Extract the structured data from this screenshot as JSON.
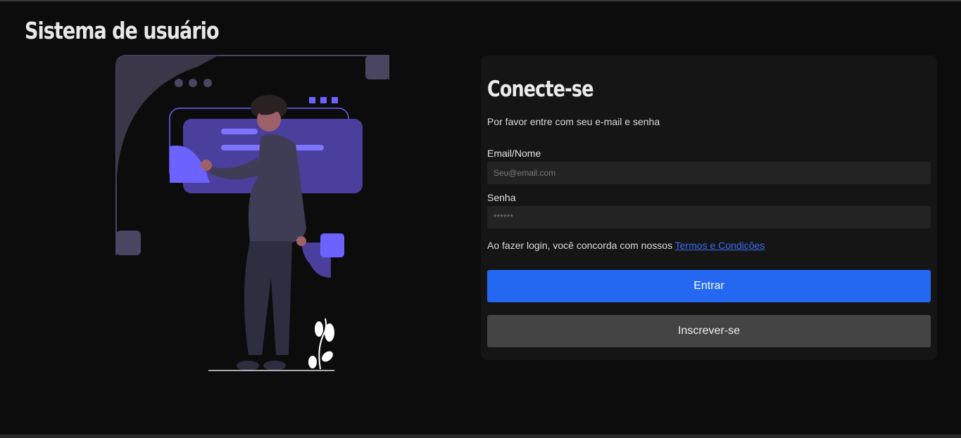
{
  "app": {
    "title": "Sistema de usuário"
  },
  "login": {
    "title": "Conecte-se",
    "subtitle": "Por favor entre com seu e-mail e senha",
    "email_label": "Email/Nome",
    "email_placeholder": "Seu@email.com",
    "password_label": "Senha",
    "password_placeholder": "******",
    "terms_text": "Ao fazer login, você concorda com nossos ",
    "terms_link": "Termos e Condições",
    "submit_label": "Entrar",
    "signup_label": "Inscrever-se"
  },
  "colors": {
    "background": "#0c0c0c",
    "card": "#151515",
    "input": "#232323",
    "primary_button": "#2468f2",
    "secondary_button": "#444444",
    "link": "#3b6cf5",
    "illustration_accent": "#6c63ff"
  },
  "illustration": {
    "icon": "person-using-dashboard-illustration"
  }
}
